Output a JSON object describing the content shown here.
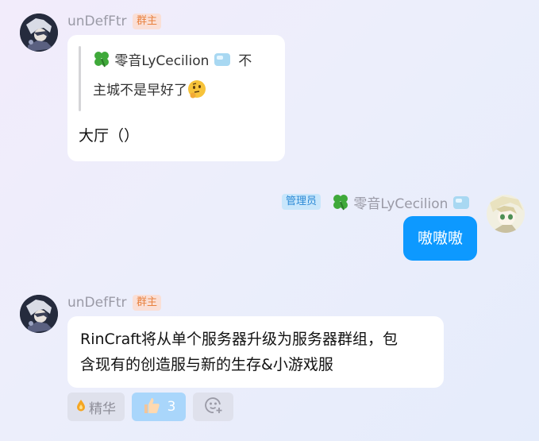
{
  "messages": [
    {
      "sender": "unDefFtr",
      "badge": "群主",
      "quote": {
        "author": "零音LyCecilion",
        "text_line1_tail": "不",
        "text_line2": "主城不是早好了"
      },
      "text": "大厅（）"
    },
    {
      "sender": "零音LyCecilion",
      "badge": "管理员",
      "text": "嗷嗷嗷"
    },
    {
      "sender": "unDefFtr",
      "badge": "群主",
      "text_line1": "RinCraft将从单个服务器升级为服务器群组，包",
      "text_line2": "含现有的创造服与新的生存&小游戏服"
    }
  ],
  "reactions": {
    "essence_label": "精华",
    "thumbs_count": "3"
  },
  "icons": {
    "essence": "fire-drop-icon",
    "thumbs": "thumbs-up-icon",
    "add_emoji": "smiley-plus-icon",
    "clover": "four-leaf-clover-icon",
    "ice": "ice-cube-icon",
    "thinking": "thinking-face-icon"
  },
  "colors": {
    "self_bubble": "#0d99ff",
    "owner_badge_bg": "#fadfd6",
    "owner_badge_fg": "#e8813f",
    "admin_badge_bg": "#c8e6fb",
    "admin_badge_fg": "#2d8ad6"
  }
}
